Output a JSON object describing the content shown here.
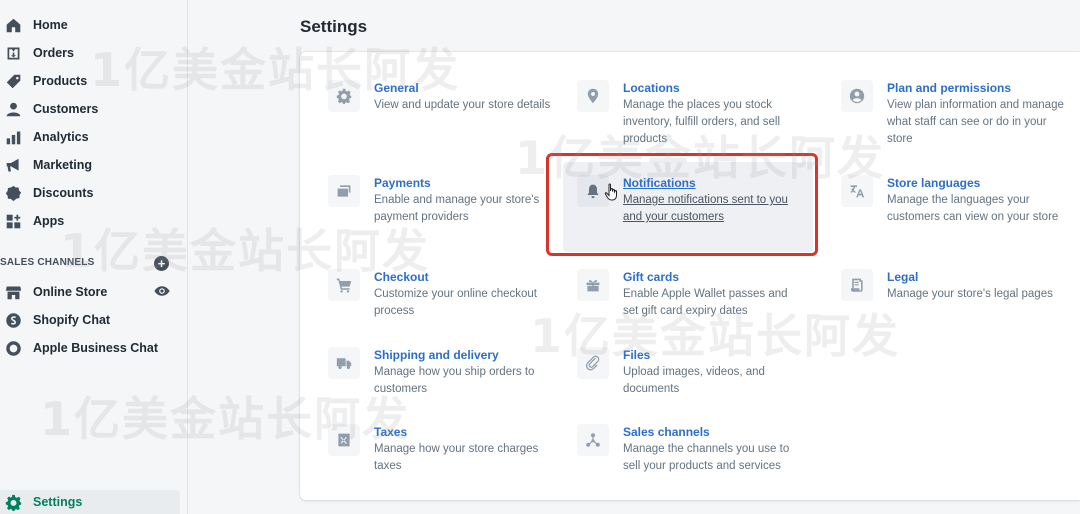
{
  "sidebar": {
    "items": [
      {
        "label": "Home",
        "icon": "home-icon"
      },
      {
        "label": "Orders",
        "icon": "orders-icon"
      },
      {
        "label": "Products",
        "icon": "tag-icon"
      },
      {
        "label": "Customers",
        "icon": "person-icon"
      },
      {
        "label": "Analytics",
        "icon": "bar-chart-icon"
      },
      {
        "label": "Marketing",
        "icon": "megaphone-icon"
      },
      {
        "label": "Discounts",
        "icon": "discount-icon"
      },
      {
        "label": "Apps",
        "icon": "apps-icon"
      }
    ],
    "sales_channels_title": "SALES CHANNELS",
    "channels": [
      {
        "label": "Online Store",
        "icon": "store-icon"
      },
      {
        "label": "Shopify Chat",
        "icon": "shopify-chat-icon"
      },
      {
        "label": "Apple Business Chat",
        "icon": "apple-chat-icon"
      }
    ],
    "settings_label": "Settings"
  },
  "main": {
    "title": "Settings",
    "tiles": [
      {
        "title": "General",
        "desc": "View and update your store details",
        "icon": "gear-icon"
      },
      {
        "title": "Locations",
        "desc": "Manage the places you stock inventory, fulfill orders, and sell products",
        "icon": "location-pin-icon"
      },
      {
        "title": "Plan and permissions",
        "desc": "View plan information and manage what staff can see or do in your store",
        "icon": "account-icon"
      },
      {
        "title": "Payments",
        "desc": "Enable and manage your store's payment providers",
        "icon": "payments-icon"
      },
      {
        "title": "Notifications",
        "desc": "Manage notifications sent to you and your customers",
        "icon": "bell-icon"
      },
      {
        "title": "Store languages",
        "desc": "Manage the languages your customers can view on your store",
        "icon": "translate-icon"
      },
      {
        "title": "Checkout",
        "desc": "Customize your online checkout process",
        "icon": "cart-icon"
      },
      {
        "title": "Gift cards",
        "desc": "Enable Apple Wallet passes and set gift card expiry dates",
        "icon": "gift-icon"
      },
      {
        "title": "Legal",
        "desc": "Manage your store's legal pages",
        "icon": "legal-icon"
      },
      {
        "title": "Shipping and delivery",
        "desc": "Manage how you ship orders to customers",
        "icon": "truck-icon"
      },
      {
        "title": "Files",
        "desc": "Upload images, videos, and documents",
        "icon": "paperclip-icon"
      },
      {
        "title": "Taxes",
        "desc": "Manage how your store charges taxes",
        "icon": "taxes-icon"
      },
      {
        "title": "Sales channels",
        "desc": "Manage the channels you use to sell your products and services",
        "icon": "sales-channels-icon"
      }
    ]
  },
  "watermark": "1亿美金站长阿发",
  "colors": {
    "accent": "#2c6ecb",
    "active": "#008060",
    "highlight_border": "#d9342b"
  }
}
